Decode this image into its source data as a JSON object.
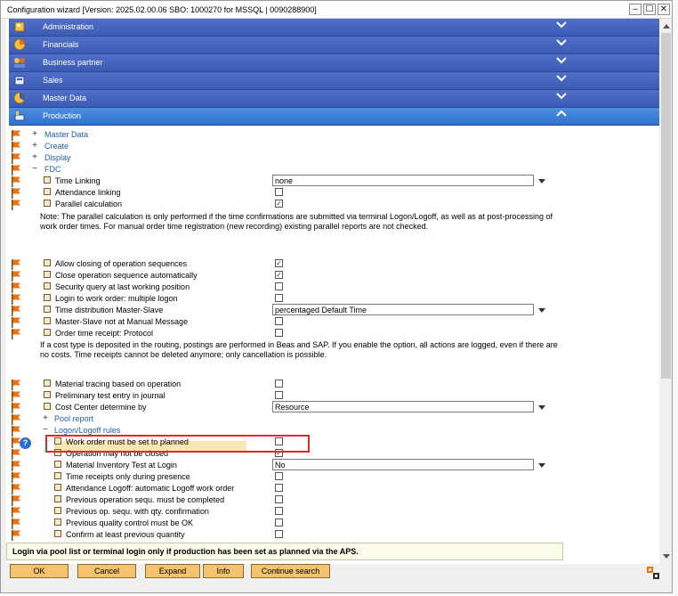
{
  "window": {
    "title": "Configuration wizard [Version: 2025.02.00.06 SBO: 1000270 for MSSQL | 0090288900]",
    "minimize": "–",
    "maximize": "☐",
    "close": "✕"
  },
  "sections": [
    {
      "label": "Administration",
      "icon": "administration-icon",
      "expanded": false
    },
    {
      "label": "Financials",
      "icon": "financials-icon",
      "expanded": false
    },
    {
      "label": "Business partner",
      "icon": "business-partner-icon",
      "expanded": false
    },
    {
      "label": "Sales",
      "icon": "sales-icon",
      "expanded": false
    },
    {
      "label": "Master Data",
      "icon": "master-data-icon",
      "expanded": false
    },
    {
      "label": "Production",
      "icon": "production-icon",
      "expanded": true
    }
  ],
  "tree": [
    {
      "sign": "+",
      "label": "Master Data"
    },
    {
      "sign": "+",
      "label": "Create"
    },
    {
      "sign": "+",
      "label": "Display"
    },
    {
      "sign": "−",
      "label": "FDC"
    }
  ],
  "fdc_settings": [
    {
      "label": "Time Linking",
      "dropdown": "none"
    },
    {
      "label": "Attendance linking",
      "checked": false
    },
    {
      "label": "Parallel calculation",
      "checked": true
    }
  ],
  "note1": "Note: The parallel calculation is only performed if the time confirmations are submitted via terminal Logon/Logoff, as well as at post-processing of work order times. For manual order time registration (new recording) existing parallel reports are not checked.",
  "op_settings": [
    {
      "label": "Allow closing of operation sequences",
      "checked": true
    },
    {
      "label": "Close operation sequence automatically",
      "checked": true
    },
    {
      "label": "Security query at last working position",
      "checked": false
    },
    {
      "label": "Login to work order: multiple logon",
      "checked": false
    },
    {
      "label": "Time distribution Master-Slave",
      "dropdown": "percentaged Default Time"
    },
    {
      "label": "Master-Slave not at Manual Message",
      "checked": false
    },
    {
      "label": "Order time receipt: Protocol",
      "checked": false
    }
  ],
  "note2": "If a cost type is deposited in the routing, postings are performed in Beas and SAP. If you enable the option, all actions are logged, even if there are no costs. Time receipts cannot be deleted anymore; only cancellation is possible.",
  "material_settings": [
    {
      "label": "Material tracing based on operation",
      "checked": false
    },
    {
      "label": "Preliminary test entry in journal",
      "checked": false
    },
    {
      "label": "Cost Center determine by",
      "dropdown": "Resource"
    }
  ],
  "pool_report": {
    "sign": "+",
    "label": "Pool report"
  },
  "logon_rules": {
    "sign": "−",
    "label": "Logon/Logoff rules"
  },
  "logon_settings": [
    {
      "label": "Work order must be set to planned",
      "checked": false
    },
    {
      "label": "Operation may not be closed",
      "checked": true
    },
    {
      "label": "Material Inventory Test at Login",
      "dropdown": "No"
    },
    {
      "label": "Time receipts only during presence",
      "checked": false
    },
    {
      "label": "Attendance Logoff: automatic Logoff work order",
      "checked": false
    },
    {
      "label": "Previous operation sequ. must be completed",
      "checked": false
    },
    {
      "label": "Previous op. sequ. with qty. confirmation",
      "checked": false
    },
    {
      "label": "Previous quality control must be OK",
      "checked": false
    },
    {
      "label": "Confirm at least previous quantity",
      "checked": false
    }
  ],
  "help_icon": "?",
  "status_text": "Login via pool list or terminal login only if production has been set as planned via the APS.",
  "buttons": {
    "ok": "OK",
    "cancel": "Cancel",
    "expand": "Expand",
    "info": "Info",
    "continue_search": "Continue search"
  },
  "colors": {
    "section_header": "#3b5bb5",
    "section_active": "#2f71cc",
    "link": "#1f5fb5",
    "button": "#f3c36e",
    "highlight": "#f8e6b4",
    "red_box": "#e02a2a"
  }
}
